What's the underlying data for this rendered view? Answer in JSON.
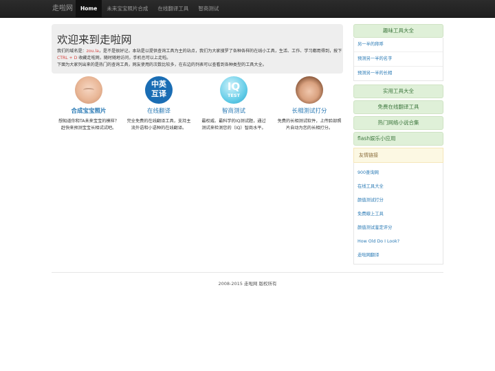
{
  "navbar": {
    "brand": "走啦网",
    "items": [
      {
        "label": "Home",
        "active": true
      },
      {
        "label": "未来宝宝照片合成",
        "active": false
      },
      {
        "label": "在线翻译工具",
        "active": false
      },
      {
        "label": "智商测试",
        "active": false
      }
    ]
  },
  "hero": {
    "title": "欢迎来到走啦网",
    "line1_prefix": "我们的域名是：",
    "domain": "zou.la",
    "line1_suffix": "，是不是很好记，本站是以提供查询工具为主的站点，我们为大家搜罗了各种各样的在线小工具，生活、工作、学习都用得到，按下",
    "shortcut": "CTRL + D",
    "line1_end": "收藏走啦网，随时随地访问，手机也可以上走啦。",
    "line2": "下面为大家列出来的是热门的查询工具，网友使用的次数比较多，在右边的列表可以查看到各种类型的工具大全。"
  },
  "features": [
    {
      "icon": "baby-photo-icon",
      "title": "合成宝宝照片",
      "desc": "想知道你和TA未来宝宝的模样？赶快来预测宝宝长相试试吧。"
    },
    {
      "icon": "translate-icon",
      "title": "在线翻译",
      "icon_text": [
        "中英",
        "互译"
      ],
      "desc": "完全免费的在线翻译工具，支持主流外语和小语种的在线翻译。"
    },
    {
      "icon": "iq-test-icon",
      "title": "智商测试",
      "icon_text": [
        "IQ",
        "TEST"
      ],
      "desc": "最权威、最科学的IQ测试题，通过测试来检测您的（IQ）智商水平。"
    },
    {
      "icon": "face-score-icon",
      "title": "长相测试打分",
      "desc": "免费的长相测试软件，上传脸部照片自动为您的长相打分。"
    }
  ],
  "sidebar": {
    "fun_tools": {
      "title": "趣味工具大全",
      "links": [
        "另一半的称呼",
        "预测另一半的名字",
        "预测另一半的长相"
      ]
    },
    "headers": [
      "实用工具大全",
      "免费在线翻译工具",
      "热门网络小说合集",
      "flash娱乐小应用"
    ]
  },
  "friends": {
    "title": "友情链接",
    "links": [
      "900查询网",
      "在线工具大全",
      "颜值测试打分",
      "免费線上工具",
      "颜值测试鉴定评分",
      "How Old Do I Look?",
      "走啦网翻译"
    ]
  },
  "footer": {
    "text": "2008-2015 走啦网 版权所有"
  }
}
